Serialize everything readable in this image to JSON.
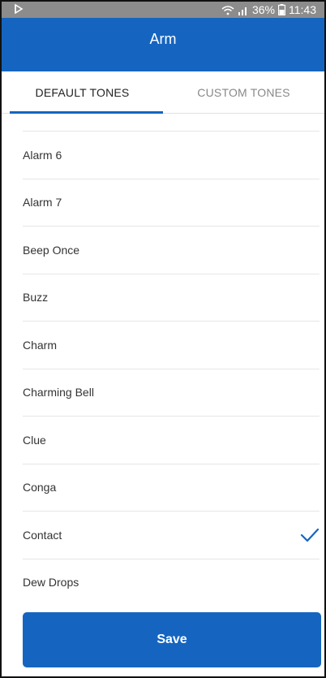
{
  "status_bar": {
    "battery": "36%",
    "time": "11:43",
    "icons": [
      "media-icon",
      "wifi-icon",
      "signal-icon",
      "battery-icon"
    ]
  },
  "app_bar": {
    "title": "Arm"
  },
  "tabs": [
    {
      "label": "DEFAULT TONES",
      "active": true
    },
    {
      "label": "CUSTOM TONES",
      "active": false
    }
  ],
  "tones": [
    {
      "label": "Alarm 6",
      "selected": false
    },
    {
      "label": "Alarm 7",
      "selected": false
    },
    {
      "label": "Beep Once",
      "selected": false
    },
    {
      "label": "Buzz",
      "selected": false
    },
    {
      "label": "Charm",
      "selected": false
    },
    {
      "label": "Charming Bell",
      "selected": false
    },
    {
      "label": "Clue",
      "selected": false
    },
    {
      "label": "Conga",
      "selected": false
    },
    {
      "label": "Contact",
      "selected": true
    },
    {
      "label": "Dew Drops",
      "selected": false
    }
  ],
  "save": {
    "label": "Save"
  },
  "colors": {
    "primary": "#1565c0",
    "status_bar": "#8c8c8c"
  }
}
